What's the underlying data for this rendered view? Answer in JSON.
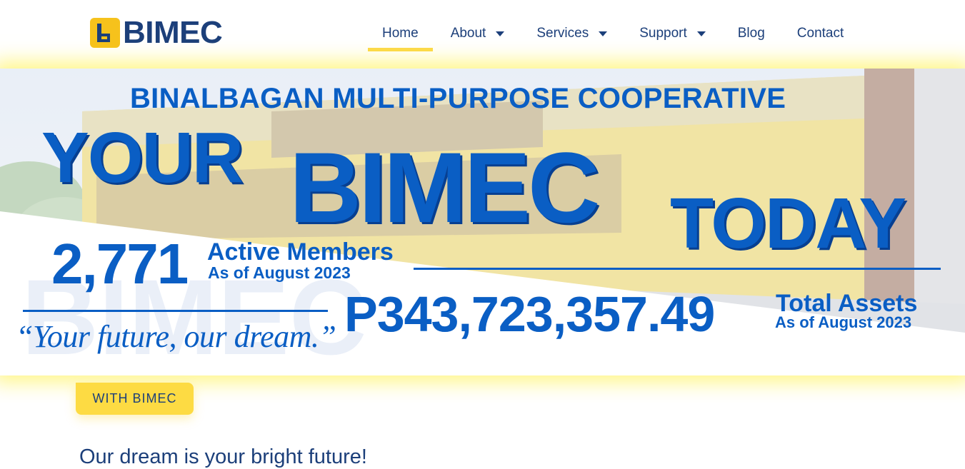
{
  "brand": {
    "logo_text": "BIMEC",
    "icon": "bimec-logo-icon"
  },
  "nav": {
    "items": [
      {
        "label": "Home",
        "active": true
      },
      {
        "label": "About",
        "dropdown": true
      },
      {
        "label": "Services",
        "dropdown": true
      },
      {
        "label": "Support",
        "dropdown": true
      },
      {
        "label": "Blog"
      },
      {
        "label": "Contact"
      }
    ]
  },
  "hero": {
    "subtitle": "BINALBAGAN MULTI-PURPOSE COOPERATIVE",
    "headline_your": "YOUR",
    "headline_bimec": "BIMEC",
    "headline_today": "TODAY",
    "members": {
      "value": "2,771",
      "label": "Active Members",
      "date": "As of August 2023"
    },
    "assets": {
      "value": "P343,723,357.49",
      "label": "Total Assets",
      "date": "As of August 2023"
    },
    "tagline": "“Your future, our dream.”"
  },
  "intro": {
    "badge": "WITH BIMEC",
    "title": "Our dream is your bright future!"
  },
  "colors": {
    "brand_blue": "#1c3f7a",
    "hero_blue": "#0a5ec4",
    "accent_yellow": "#fddb43"
  }
}
